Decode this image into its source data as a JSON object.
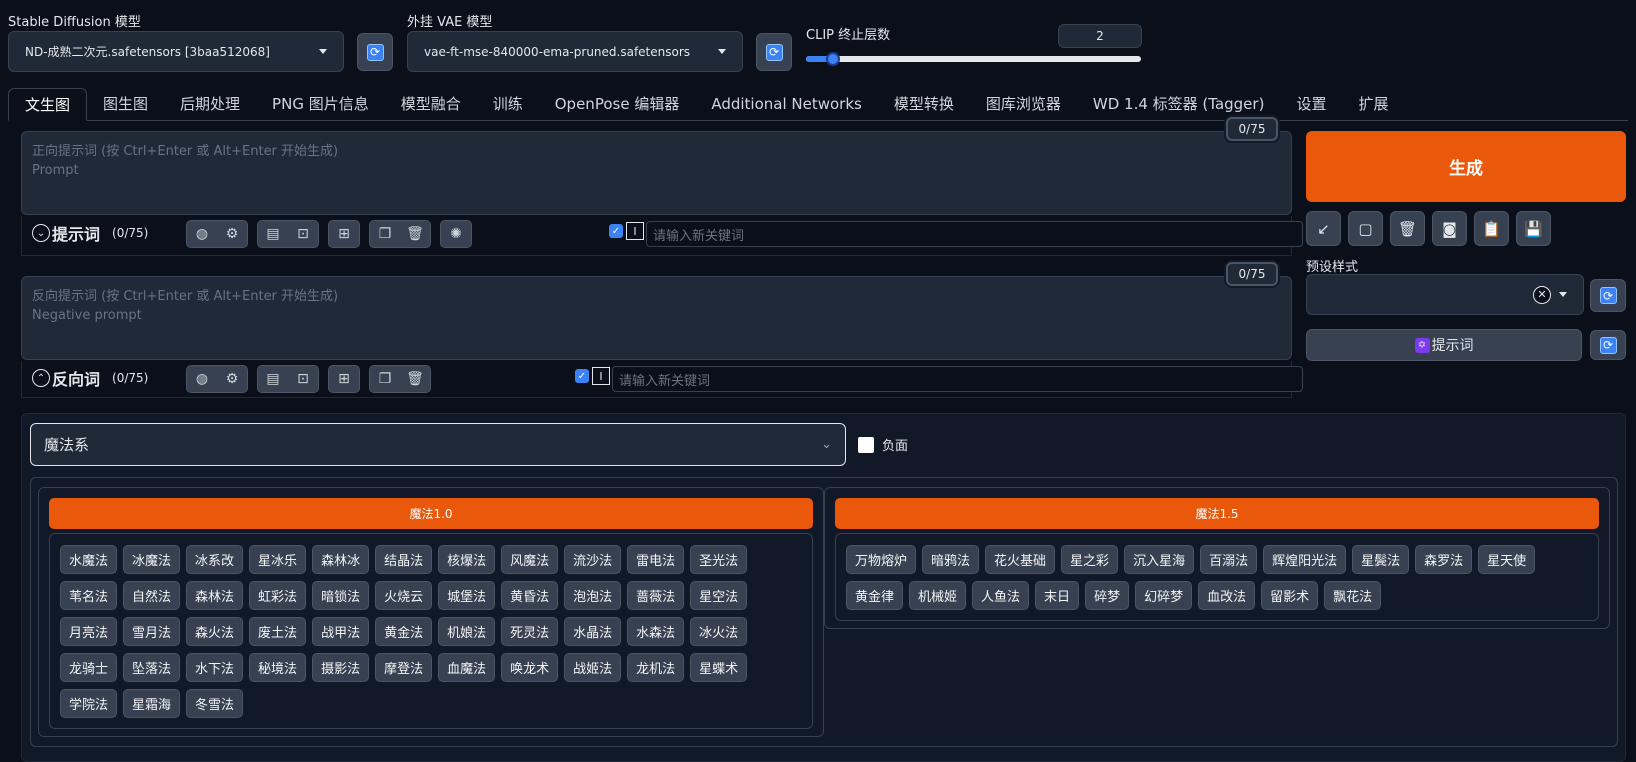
{
  "top": {
    "sd_label": "Stable Diffusion 模型",
    "sd_value": "ND-成熟二次元.safetensors [3baa512068]",
    "vae_label": "外挂 VAE 模型",
    "vae_value": "vae-ft-mse-840000-ema-pruned.safetensors",
    "clip_label": "CLIP 终止层数",
    "clip_value": "2",
    "clip_slider_fraction": 0.08
  },
  "tabs": [
    "文生图",
    "图生图",
    "后期处理",
    "PNG 图片信息",
    "模型融合",
    "训练",
    "OpenPose 编辑器",
    "Additional Networks",
    "模型转换",
    "图库浏览器",
    "WD 1.4 标签器 (Tagger)",
    "设置",
    "扩展"
  ],
  "prompt": {
    "placeholder1": "正向提示词 (按 Ctrl+Enter 或 Alt+Enter 开始生成)",
    "placeholder2": "Prompt",
    "counter": "0/75",
    "toggle_label": "提示词",
    "toggle_count": "(0/75)",
    "kw_placeholder": "请输入新关键词"
  },
  "negative": {
    "placeholder1": "反向提示词 (按 Ctrl+Enter 或 Alt+Enter 开始生成)",
    "placeholder2": "Negative prompt",
    "counter": "0/75",
    "toggle_label": "反向词",
    "toggle_count": "(0/75)",
    "kw_placeholder": "请输入新关键词"
  },
  "right": {
    "generate": "生成",
    "styles_label": "预设样式",
    "prompt_btn": "提示词"
  },
  "magic": {
    "select_value": "魔法系",
    "negative_label": "负面",
    "group1_title": "魔法1.0",
    "group1_items": [
      "水魔法",
      "冰魔法",
      "冰系改",
      "星冰乐",
      "森林冰",
      "结晶法",
      "核爆法",
      "风魔法",
      "流沙法",
      "雷电法",
      "圣光法",
      "苇名法",
      "自然法",
      "森林法",
      "虹彩法",
      "暗锁法",
      "火烧云",
      "城堡法",
      "黄昏法",
      "泡泡法",
      "蔷薇法",
      "星空法",
      "月亮法",
      "雪月法",
      "森火法",
      "废土法",
      "战甲法",
      "黄金法",
      "机娘法",
      "死灵法",
      "水晶法",
      "水森法",
      "冰火法",
      "龙骑士",
      "坠落法",
      "水下法",
      "秘境法",
      "摄影法",
      "摩登法",
      "血魔法",
      "唤龙术",
      "战姬法",
      "龙机法",
      "星蝶术",
      "学院法",
      "星霜海",
      "冬雪法"
    ],
    "group2_title": "魔法1.5",
    "group2_items": [
      "万物熔炉",
      "暗鸦法",
      "花火基础",
      "星之彩",
      "沉入星海",
      "百溺法",
      "辉煌阳光法",
      "星鬓法",
      "森罗法",
      "星天使",
      "黄金律",
      "机械姬",
      "人鱼法",
      "末日",
      "碎梦",
      "幻碎梦",
      "血改法",
      "留影术",
      "飘花法"
    ]
  }
}
